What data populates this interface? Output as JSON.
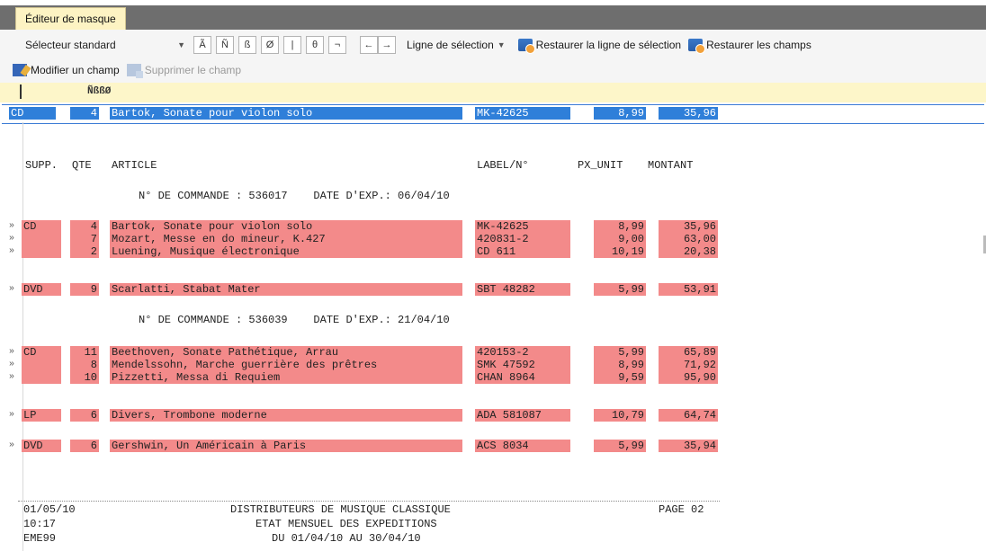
{
  "tab": {
    "title": "Éditeur de masque"
  },
  "toolbar": {
    "selector": "Sélecteur standard",
    "glyph_buttons": [
      "Ã",
      "Ñ",
      "ß",
      "Ø",
      "|",
      "θ",
      "¬"
    ],
    "arrow_left": "←",
    "arrow_right": "→",
    "selection_line": "Ligne de sélection",
    "restore_line": "Restaurer la ligne de sélection",
    "restore_fields": "Restaurer les champs",
    "modify_field": "Modifier un champ",
    "delete_field": "Supprimer le champ"
  },
  "editor": {
    "mask_chars": "ÑßßØ",
    "selected_line": {
      "supp": "CD",
      "qte": "4",
      "article": "Bartok, Sonate pour violon solo",
      "label": "MK-42625",
      "px": "8,99",
      "montant": "35,96"
    },
    "headers": {
      "supp": "SUPP.",
      "qte": "QTE",
      "article": "ARTICLE",
      "label": "LABEL/N°",
      "px": "PX_UNIT",
      "montant": "MONTANT"
    },
    "orders": [
      {
        "text": "N° DE COMMANDE : 536017    DATE D'EXP.: 06/04/10"
      },
      {
        "text": "N° DE COMMANDE : 536039    DATE D'EXP.: 21/04/10"
      }
    ],
    "rows": [
      {
        "supp": "CD",
        "qte": "4",
        "article": "Bartok, Sonate pour violon solo",
        "label": "MK-42625",
        "px": "8,99",
        "montant": "35,96"
      },
      {
        "supp": "",
        "qte": "7",
        "article": "Mozart, Messe en do mineur, K.427",
        "label": "420831-2",
        "px": "9,00",
        "montant": "63,00"
      },
      {
        "supp": "",
        "qte": "2",
        "article": "Luening, Musique électronique",
        "label": "CD 611",
        "px": "10,19",
        "montant": "20,38"
      },
      {
        "supp": "DVD",
        "qte": "9",
        "article": "Scarlatti, Stabat Mater",
        "label": "SBT 48282",
        "px": "5,99",
        "montant": "53,91"
      },
      {
        "supp": "CD",
        "qte": "11",
        "article": "Beethoven, Sonate Pathétique, Arrau",
        "label": "420153-2",
        "px": "5,99",
        "montant": "65,89"
      },
      {
        "supp": "",
        "qte": "8",
        "article": "Mendelssohn, Marche guerrière des prêtres",
        "label": "SMK 47592",
        "px": "8,99",
        "montant": "71,92"
      },
      {
        "supp": "",
        "qte": "10",
        "article": "Pizzetti, Messa di Requiem",
        "label": "CHAN 8964",
        "px": "9,59",
        "montant": "95,90"
      },
      {
        "supp": "LP",
        "qte": "6",
        "article": "Divers, Trombone moderne",
        "label": "ADA 581087",
        "px": "10,79",
        "montant": "64,74"
      },
      {
        "supp": "DVD",
        "qte": "6",
        "article": "Gershwin, Un Américain à Paris",
        "label": "ACS 8034",
        "px": "5,99",
        "montant": "35,94"
      }
    ],
    "row_arrow": "»",
    "footer": {
      "date": "01/05/10",
      "time": "10:17",
      "code": "EME99",
      "company": "DISTRIBUTEURS DE MUSIQUE CLASSIQUE",
      "report": "ETAT MENSUEL DES EXPEDITIONS",
      "period": "DU 01/04/10 AU 30/04/10",
      "page": "PAGE 02"
    }
  },
  "colors": {
    "field_highlight": "#f38a8a",
    "selection": "#2f7fd9",
    "tab": "#fdf3c3"
  }
}
